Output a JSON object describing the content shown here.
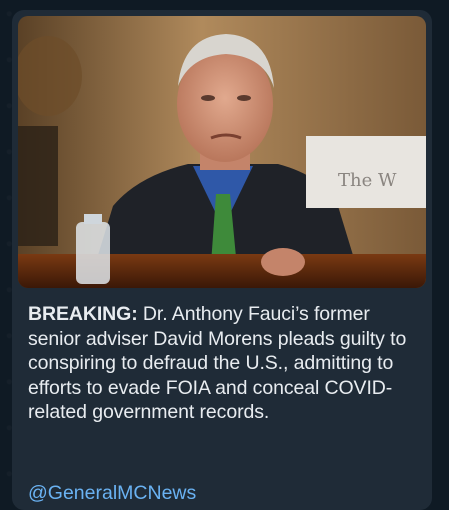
{
  "message": {
    "caption_lead": "BREAKING:",
    "caption_body": " Dr. Anthony Fauci’s former senior adviser David Morens pleads guilty to conspiring to defraud the U.S., admitting to efforts to evade FOIA and conceal COVID-related government records.",
    "channel_handle": "@GeneralMCNews"
  },
  "photo": {
    "description_icon": "news-photo"
  },
  "colors": {
    "chat_background": "#0f1a24",
    "bubble": "#1f2b37",
    "text": "#e8ecf0",
    "link": "#6ab2f2"
  }
}
